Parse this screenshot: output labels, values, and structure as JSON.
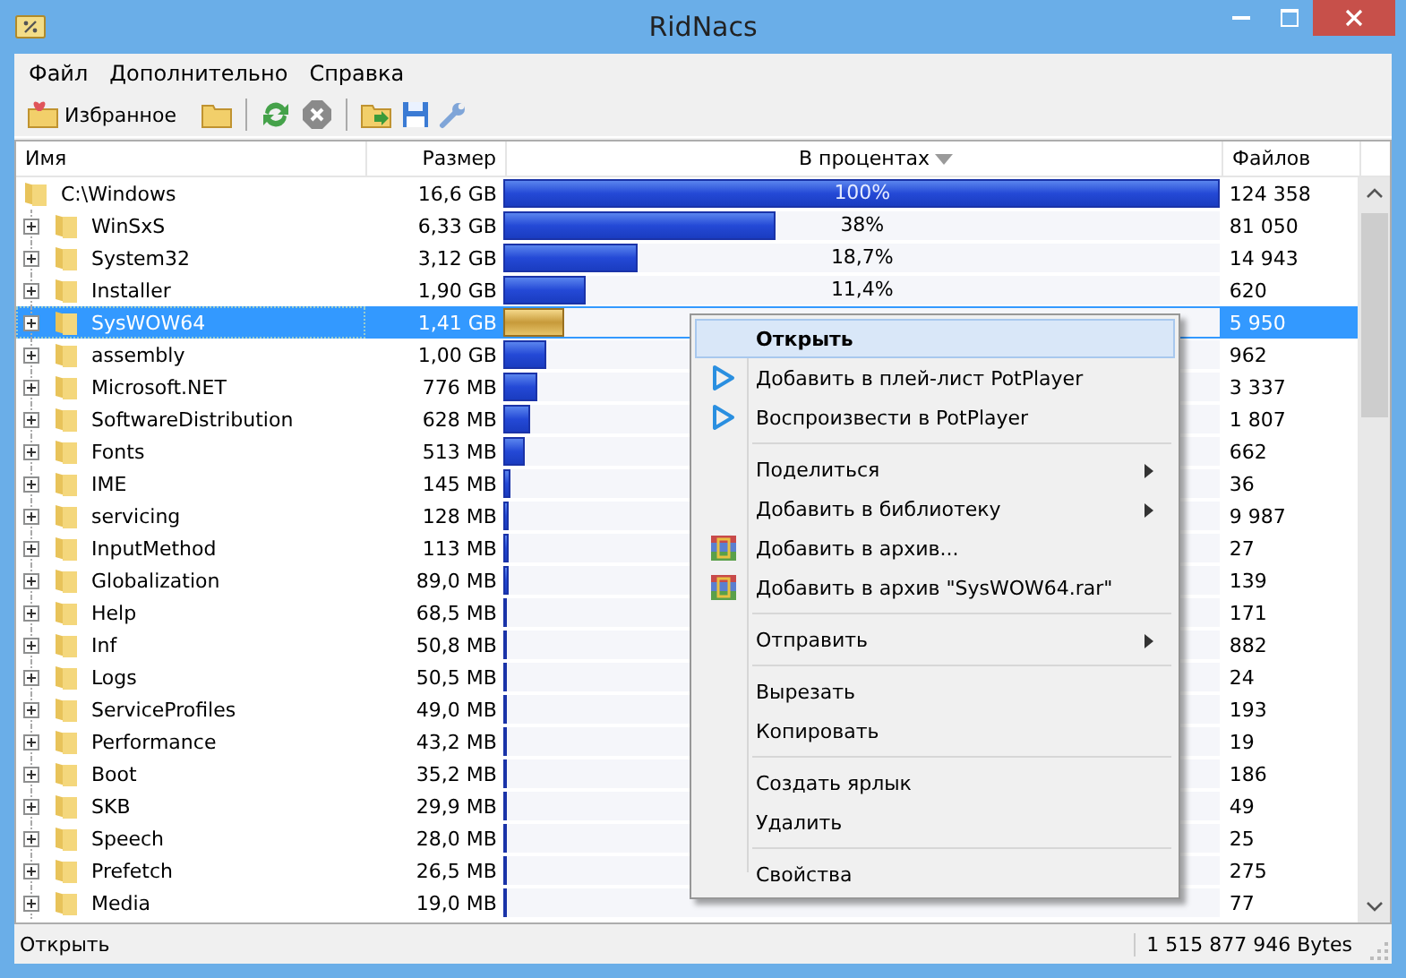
{
  "window": {
    "title": "RidNacs"
  },
  "menu": [
    "Файл",
    "Дополнительно",
    "Справка"
  ],
  "toolbar": {
    "favorites": "Избранное"
  },
  "table": {
    "columns": [
      "Имя",
      "Размер",
      "В процентах",
      "Файлов"
    ],
    "root": {
      "name": "C:\\Windows",
      "size": "16,6 GB",
      "level": 1,
      "percent": "100%",
      "files": "124 358",
      "selected": false,
      "children": [
        {
          "name": "WinSxS",
          "size": "6,33 GB",
          "level": 0.38,
          "percent": "38%",
          "files": "81 050",
          "selected": false,
          "expanded": false
        },
        {
          "name": "System32",
          "size": "3,12 GB",
          "level": 0.187,
          "percent": "18,7%",
          "files": "14 943",
          "selected": false,
          "expanded": false
        },
        {
          "name": "Installer",
          "size": "1,90 GB",
          "level": 0.114,
          "percent": "11,4%",
          "files": "620",
          "selected": false,
          "expanded": false
        },
        {
          "name": "SysWOW64",
          "size": "1,41 GB",
          "level": 0.085,
          "files": "5 950",
          "selected": true,
          "expanded": false
        },
        {
          "name": "assembly",
          "size": "1,00 GB",
          "level": 0.06,
          "files": "962",
          "selected": false,
          "expanded": false
        },
        {
          "name": "Microsoft.NET",
          "size": "776 MB",
          "level": 0.046,
          "files": "3 337",
          "selected": false,
          "expanded": false
        },
        {
          "name": "SoftwareDistribution",
          "size": "628 MB",
          "level": 0.037,
          "files": "1 807",
          "selected": false,
          "expanded": false
        },
        {
          "name": "Fonts",
          "size": "513 MB",
          "level": 0.03,
          "files": "662",
          "selected": false,
          "expanded": false
        },
        {
          "name": "IME",
          "size": "145 MB",
          "level": 0.0085,
          "files": "36",
          "selected": false,
          "expanded": false
        },
        {
          "name": "servicing",
          "size": "128 MB",
          "level": 0.0075,
          "files": "9 987",
          "selected": false,
          "expanded": false
        },
        {
          "name": "InputMethod",
          "size": "113 MB",
          "level": 0.0066,
          "files": "27",
          "selected": false,
          "expanded": false
        },
        {
          "name": "Globalization",
          "size": "89,0 MB",
          "level": 0.0052,
          "files": "139",
          "selected": false,
          "expanded": false
        },
        {
          "name": "Help",
          "size": "68,5 MB",
          "level": 0.004,
          "files": "171",
          "selected": false,
          "expanded": false
        },
        {
          "name": "Inf",
          "size": "50,8 MB",
          "level": 0.003,
          "files": "882",
          "selected": false,
          "expanded": false
        },
        {
          "name": "Logs",
          "size": "50,5 MB",
          "level": 0.003,
          "files": "24",
          "selected": false,
          "expanded": false
        },
        {
          "name": "ServiceProfiles",
          "size": "49,0 MB",
          "level": 0.0029,
          "files": "193",
          "selected": false,
          "expanded": false
        },
        {
          "name": "Performance",
          "size": "43,2 MB",
          "level": 0.0025,
          "files": "19",
          "selected": false,
          "expanded": false
        },
        {
          "name": "Boot",
          "size": "35,2 MB",
          "level": 0.0021,
          "files": "186",
          "selected": false,
          "expanded": false
        },
        {
          "name": "SKB",
          "size": "29,9 MB",
          "level": 0.0018,
          "files": "49",
          "selected": false,
          "expanded": false
        },
        {
          "name": "Speech",
          "size": "28,0 MB",
          "level": 0.0016,
          "files": "25",
          "selected": false,
          "expanded": false
        },
        {
          "name": "Prefetch",
          "size": "26,5 MB",
          "level": 0.0016,
          "files": "275",
          "selected": false,
          "expanded": false
        },
        {
          "name": "Media",
          "size": "19,0 MB",
          "level": 0.0011,
          "files": "77",
          "selected": false,
          "expanded": false
        }
      ]
    }
  },
  "context_menu": [
    {
      "kind": "default",
      "label": "Открыть",
      "selected": true
    },
    {
      "kind": "player",
      "label": "Добавить в плей-лист PotPlayer",
      "selected": false
    },
    {
      "kind": "player",
      "label": "Воспроизвести в PotPlayer",
      "selected": false
    },
    {
      "kind": "separator"
    },
    {
      "kind": "submenu",
      "label": "Поделиться",
      "selected": false
    },
    {
      "kind": "submenu",
      "label": "Добавить в библиотеку",
      "selected": false
    },
    {
      "kind": "archive",
      "label": "Добавить в архив...",
      "selected": false
    },
    {
      "kind": "archive",
      "label": "Добавить в архив \"SysWOW64.rar\"",
      "selected": false
    },
    {
      "kind": "separator"
    },
    {
      "kind": "submenu",
      "label": "Отправить",
      "selected": false
    },
    {
      "kind": "separator"
    },
    {
      "kind": "plain",
      "label": "Вырезать",
      "selected": false
    },
    {
      "kind": "plain",
      "label": "Копировать",
      "selected": false
    },
    {
      "kind": "separator"
    },
    {
      "kind": "plain",
      "label": "Создать ярлык",
      "selected": false
    },
    {
      "kind": "plain",
      "label": "Удалить",
      "selected": false
    },
    {
      "kind": "separator"
    },
    {
      "kind": "plain",
      "label": "Свойства",
      "selected": false
    }
  ],
  "status_bar": {
    "left": "Открыть",
    "right": "1 515 877 946 Bytes"
  }
}
